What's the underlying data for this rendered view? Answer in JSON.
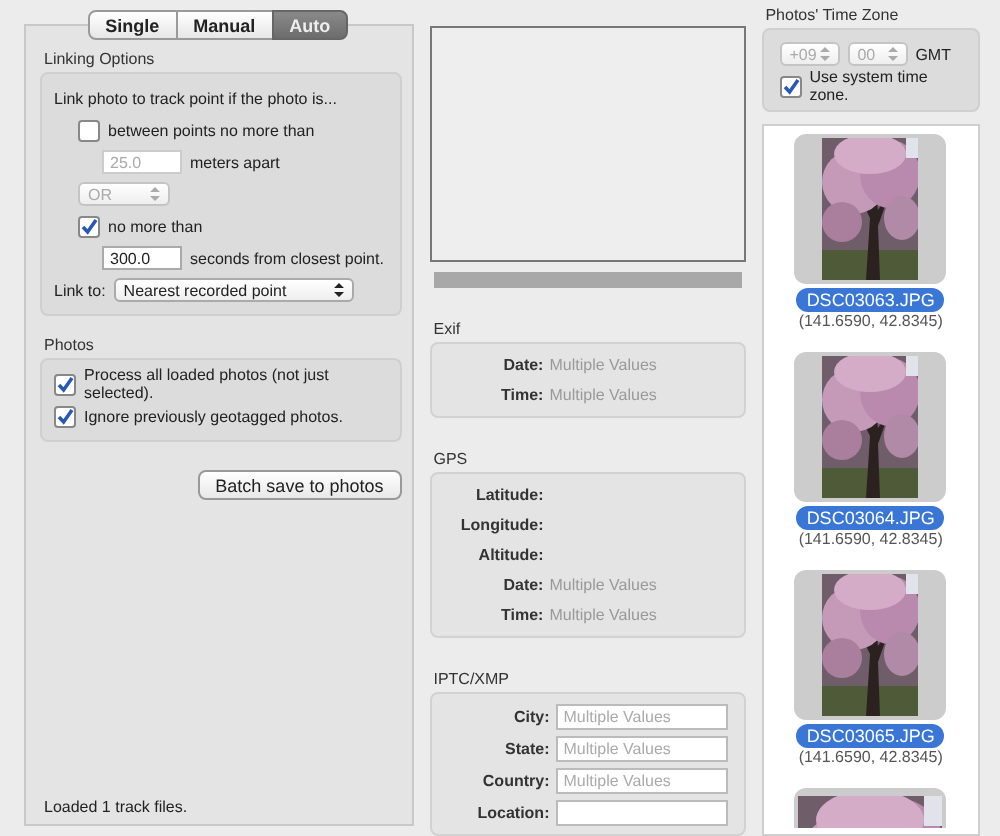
{
  "tabs": [
    {
      "label": "Single",
      "selected": false
    },
    {
      "label": "Manual",
      "selected": false
    },
    {
      "label": "Auto",
      "selected": true
    }
  ],
  "linking_options": {
    "title": "Linking Options",
    "intro": "Link photo to track point if the photo is...",
    "between": {
      "label": "between points no more than",
      "checked": false
    },
    "distance": {
      "value": "25.0",
      "unit": "meters apart",
      "disabled": true
    },
    "operator": {
      "value": "OR",
      "disabled": true
    },
    "time": {
      "label": "no more than",
      "checked": true
    },
    "seconds": {
      "value": "300.0",
      "unit": "seconds from closest point.",
      "disabled": false
    },
    "link_to": {
      "label": "Link to:",
      "value": "Nearest recorded point"
    }
  },
  "photos_options": {
    "title": "Photos",
    "options": [
      {
        "label": "Process all loaded photos (not just selected).",
        "checked": true
      },
      {
        "label": "Ignore previously geotagged photos.",
        "checked": true
      }
    ]
  },
  "batch_button": "Batch save to photos",
  "status_bar": "Loaded 1 track files.",
  "exif": {
    "title": "Exif",
    "rows": [
      {
        "label": "Date:",
        "value": "Multiple Values"
      },
      {
        "label": "Time:",
        "value": "Multiple Values"
      }
    ]
  },
  "gps": {
    "title": "GPS",
    "rows": [
      {
        "label": "Latitude:"
      },
      {
        "label": "Longitude:"
      },
      {
        "label": "Altitude:"
      },
      {
        "label": "Date:",
        "value": "Multiple Values"
      },
      {
        "label": "Time:",
        "value": "Multiple Values"
      }
    ]
  },
  "iptc": {
    "title": "IPTC/XMP",
    "fields": [
      {
        "label": "City:",
        "placeholder": "Multiple Values"
      },
      {
        "label": "State:",
        "placeholder": "Multiple Values"
      },
      {
        "label": "Country:",
        "placeholder": "Multiple Values"
      },
      {
        "label": "Location:"
      }
    ]
  },
  "time_zone": {
    "title": "Photos' Time Zone",
    "hours": {
      "value": "+09",
      "disabled": true
    },
    "minutes": {
      "value": "00",
      "disabled": true
    },
    "suffix": "GMT",
    "use_system": {
      "label": "Use system time zone.",
      "checked": true
    }
  },
  "photos": [
    {
      "name": "DSC03063.JPG",
      "coords": "(141.6590, 42.8345)",
      "selected": true
    },
    {
      "name": "DSC03064.JPG",
      "coords": "(141.6590, 42.8345)",
      "selected": true
    },
    {
      "name": "DSC03065.JPG",
      "coords": "(141.6590, 42.8345)",
      "selected": true
    },
    {
      "kind": "picture"
    }
  ]
}
